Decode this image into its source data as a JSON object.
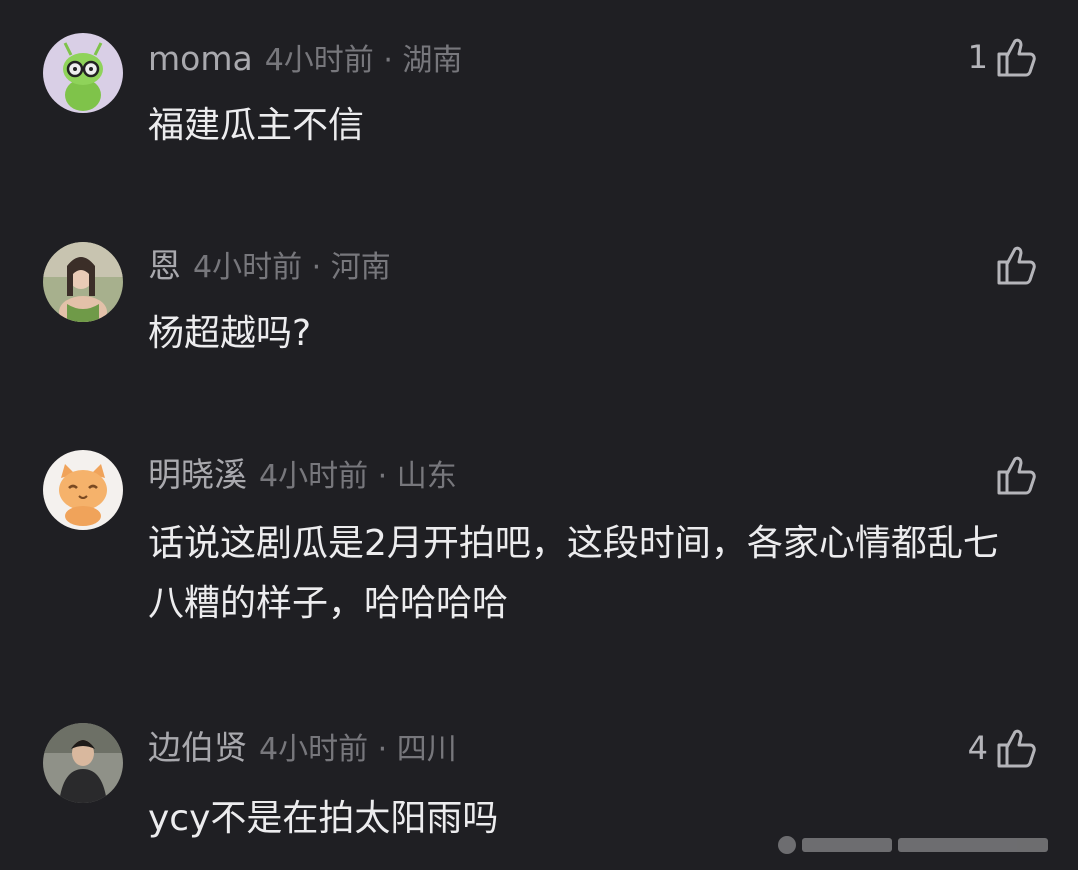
{
  "comments": [
    {
      "username": "moma",
      "time_location": "4小时前 · 湖南",
      "text": "福建瓜主不信",
      "likes": "1",
      "avatar_icon": "robot-avatar"
    },
    {
      "username": "恩",
      "time_location": "4小时前 · 河南",
      "text": "杨超越吗?",
      "likes": "",
      "avatar_icon": "photo-avatar"
    },
    {
      "username": "明晓溪",
      "time_location": "4小时前 · 山东",
      "text": "话说这剧瓜是2月开拍吧，这段时间，各家心情都乱七八糟的样子，哈哈哈哈",
      "likes": "",
      "avatar_icon": "cat-avatar"
    },
    {
      "username": "边伯贤",
      "time_location": "4小时前 · 四川",
      "text": "ycy不是在拍太阳雨吗",
      "likes": "4",
      "avatar_icon": "photo-avatar"
    }
  ],
  "colors": {
    "background": "#1f1f23",
    "text": "#ececee",
    "meta": "#77777c",
    "username": "#a9a9ae"
  }
}
